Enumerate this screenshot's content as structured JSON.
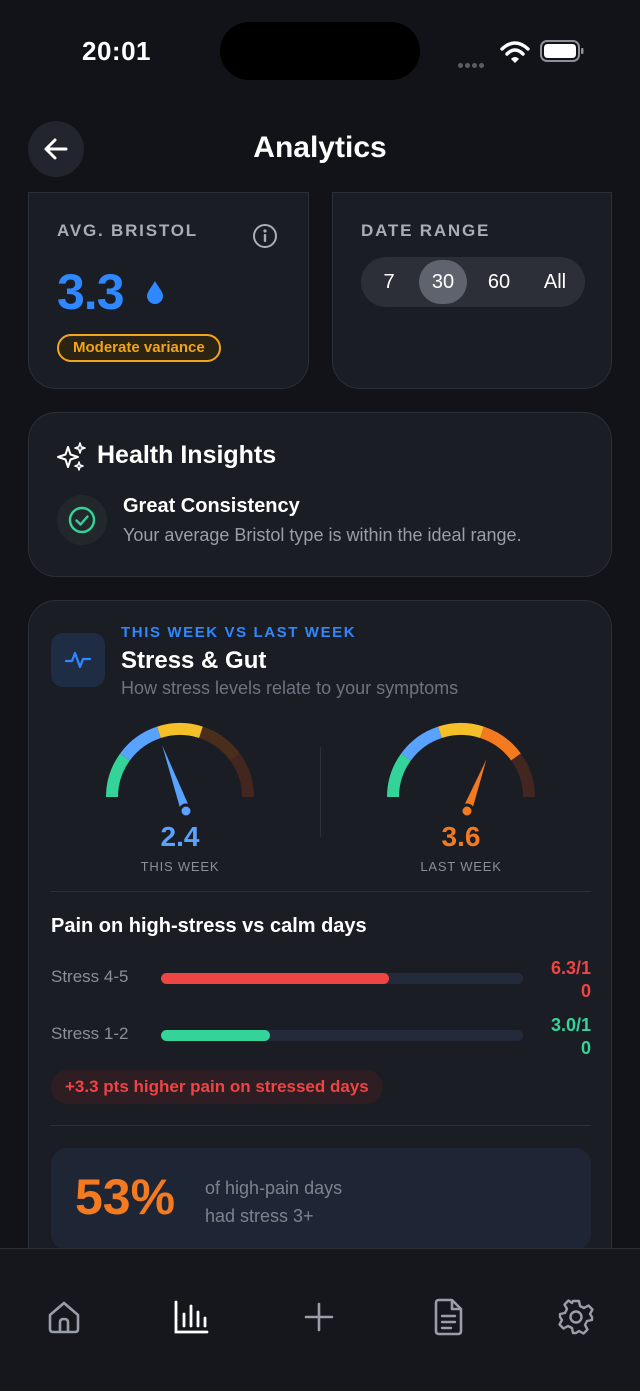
{
  "status": {
    "time": "20:01"
  },
  "header": {
    "title": "Analytics"
  },
  "avg_bristol": {
    "label": "AVG. BRISTOL",
    "value": "3.3",
    "badge": "Moderate variance"
  },
  "date_range": {
    "label": "DATE RANGE",
    "options": [
      "7",
      "30",
      "60",
      "All"
    ],
    "selected": "30"
  },
  "insights": {
    "title": "Health Insights",
    "items": [
      {
        "heading": "Great Consistency",
        "text": "Your average Bristol type is within the ideal range."
      }
    ]
  },
  "stress": {
    "eyebrow": "THIS WEEK VS LAST WEEK",
    "title": "Stress & Gut",
    "subtitle": "How stress levels relate to your symptoms",
    "this_week": {
      "value": "2.4",
      "label": "THIS WEEK",
      "level": 2.4,
      "max": 5
    },
    "last_week": {
      "value": "3.6",
      "label": "LAST WEEK",
      "level": 3.6,
      "max": 5
    },
    "pain_title": "Pain on high-stress vs calm days",
    "bars": [
      {
        "label": "Stress 4-5",
        "value_text": "6.3/10",
        "value": 6.3,
        "max": 10,
        "color": "#ef4444"
      },
      {
        "label": "Stress 1-2",
        "value_text": "3.0/10",
        "value": 3.0,
        "max": 10,
        "color": "#34d399"
      }
    ],
    "diff_chip": "+3.3 pts higher pain on stressed days",
    "pct": {
      "value": "53%",
      "line1": "of high-pain days",
      "line2": "had stress 3+"
    }
  },
  "colors": {
    "accent_blue": "#2f88ff",
    "warning_amber": "#f2a51a",
    "danger_red": "#ef4444",
    "success_green": "#34d399",
    "orange": "#f47a1f"
  },
  "tabs": [
    "home-icon",
    "chart-bar-icon",
    "plus-icon",
    "document-icon",
    "gear-icon"
  ]
}
